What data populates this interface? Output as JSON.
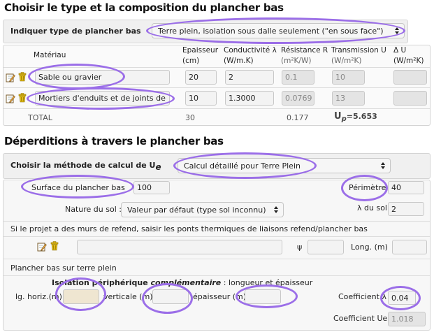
{
  "section1": {
    "title": "Choisir le type et la composition du plancher bas",
    "type_label": "Indiquer type de plancher bas",
    "type_value": "Terre plein, isolation sous dalle seulement (\"en sous face\")",
    "table": {
      "headers": {
        "materiau": "Matériau",
        "epaisseur": "Epaisseur",
        "epaisseur_unit": "(cm)",
        "conductivite": "Conductivité λ",
        "conductivite_unit": "(W/m.K)",
        "resistance": "Résistance R",
        "resistance_unit": "(m²K/W)",
        "transmission": "Transmission U",
        "transmission_unit": "(W/m²K)",
        "delta": "Δ U",
        "delta_unit": "(W/m²K)"
      },
      "rows": [
        {
          "material": "Sable ou gravier",
          "epaisseur": "20",
          "conductivite": "2",
          "resistance": "0.1",
          "transmission": "10",
          "delta": ""
        },
        {
          "material": "Mortiers d'enduits et de joints de",
          "epaisseur": "10",
          "conductivite": "1.3000",
          "resistance": "0.0769",
          "transmission": "13",
          "delta": ""
        }
      ],
      "total": {
        "label": "TOTAL",
        "epaisseur": "30",
        "resistance": "0.177",
        "u_label": "U",
        "u_sub": "p",
        "u_value": "=5.653"
      }
    }
  },
  "section2": {
    "title": "Déperditions à travers le plancher bas",
    "method_label": "Choisir la méthode de calcul de U",
    "method_sub": "e",
    "method_value": "Calcul détaillé pour Terre Plein",
    "surface_label": "Surface du plancher bas",
    "surface_value": "100",
    "perimetre_label": "Périmètre",
    "perimetre_value": "40",
    "nature_label": "Nature du sol :",
    "nature_value": "Valeur par défaut (type sol inconnu)",
    "lambda_sol_label": "λ du sol",
    "lambda_sol_value": "2",
    "refend_text": "Si le projet a des murs de refend, saisir les ponts thermiques de liaisons refend/plancher bas",
    "refend_value": "",
    "psi_label": "ψ",
    "psi_value": "",
    "long_label": "Long. (m)",
    "long_value": "",
    "terre_plein_label": "Plancher bas sur terre plein",
    "isolation_title_a": "Isolation périphérique ",
    "isolation_title_b": "complémentaire",
    "isolation_title_c": " : longueur et épaisseur",
    "lg_horiz_label": "lg. horiz.(m)",
    "lg_horiz_value": "",
    "verticale_label": "verticale (m)",
    "verticale_value": "",
    "epaisseur_label": "épaisseur (m)",
    "epaisseur_value": "",
    "coef_lambda_label": "Coefficient λ",
    "coef_lambda_value": "0.04",
    "coef_ue_label": "Coefficient Ue",
    "coef_ue_value": "1.018"
  },
  "icons": [
    "edit-icon",
    "trash-icon",
    "dropdown-caret-icon"
  ],
  "colors": {
    "highlight": "#9b6ee8",
    "trash": "#e3bd17",
    "edit": "#7a5c2e"
  }
}
